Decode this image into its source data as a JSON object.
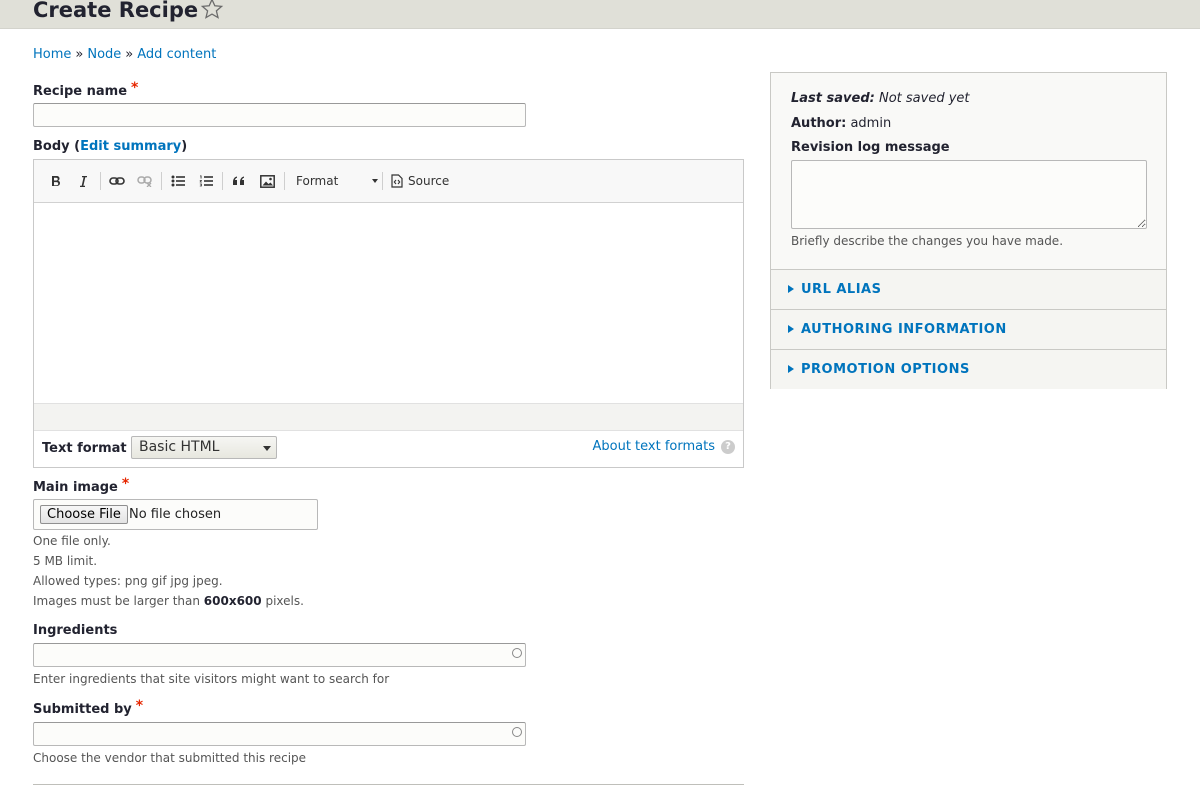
{
  "header": {
    "title": "Create Recipe"
  },
  "breadcrumb": {
    "items": [
      "Home",
      "Node",
      "Add content"
    ],
    "separator": "»"
  },
  "recipe_name": {
    "label": "Recipe name",
    "required_mark": "*",
    "value": ""
  },
  "body": {
    "label": "Body",
    "edit_summary": "Edit summary",
    "paren_open": "(",
    "paren_close": ")",
    "toolbar": {
      "format_label": "Format",
      "source_label": "Source"
    },
    "text_format": {
      "label": "Text format",
      "selected": "Basic HTML",
      "about_link": "About text formats",
      "help": "?"
    }
  },
  "main_image": {
    "label": "Main image",
    "required_mark": "*",
    "choose_button": "Choose File",
    "no_file": "No file chosen",
    "help_lines": [
      "One file only.",
      "5 MB limit.",
      "Allowed types: png gif jpg jpeg."
    ],
    "size_text_before": "Images must be larger than",
    "size_value": "600x600",
    "size_text_after": "pixels."
  },
  "ingredients": {
    "label": "Ingredients",
    "value": "",
    "description": "Enter ingredients that site visitors might want to search for"
  },
  "submitted_by": {
    "label": "Submitted by",
    "required_mark": "*",
    "value": "",
    "description": "Choose the vendor that submitted this recipe"
  },
  "sidebar": {
    "last_saved_label": "Last saved:",
    "last_saved_value": "Not saved yet",
    "author_label": "Author:",
    "author_value": "admin",
    "revision_label": "Revision log message",
    "revision_value": "",
    "revision_desc": "Briefly describe the changes you have made.",
    "sections": [
      "URL ALIAS",
      "AUTHORING INFORMATION",
      "PROMOTION OPTIONS"
    ]
  },
  "colors": {
    "link": "#0074bd",
    "required": "#e62600",
    "header_bg": "#e0e0d8"
  }
}
